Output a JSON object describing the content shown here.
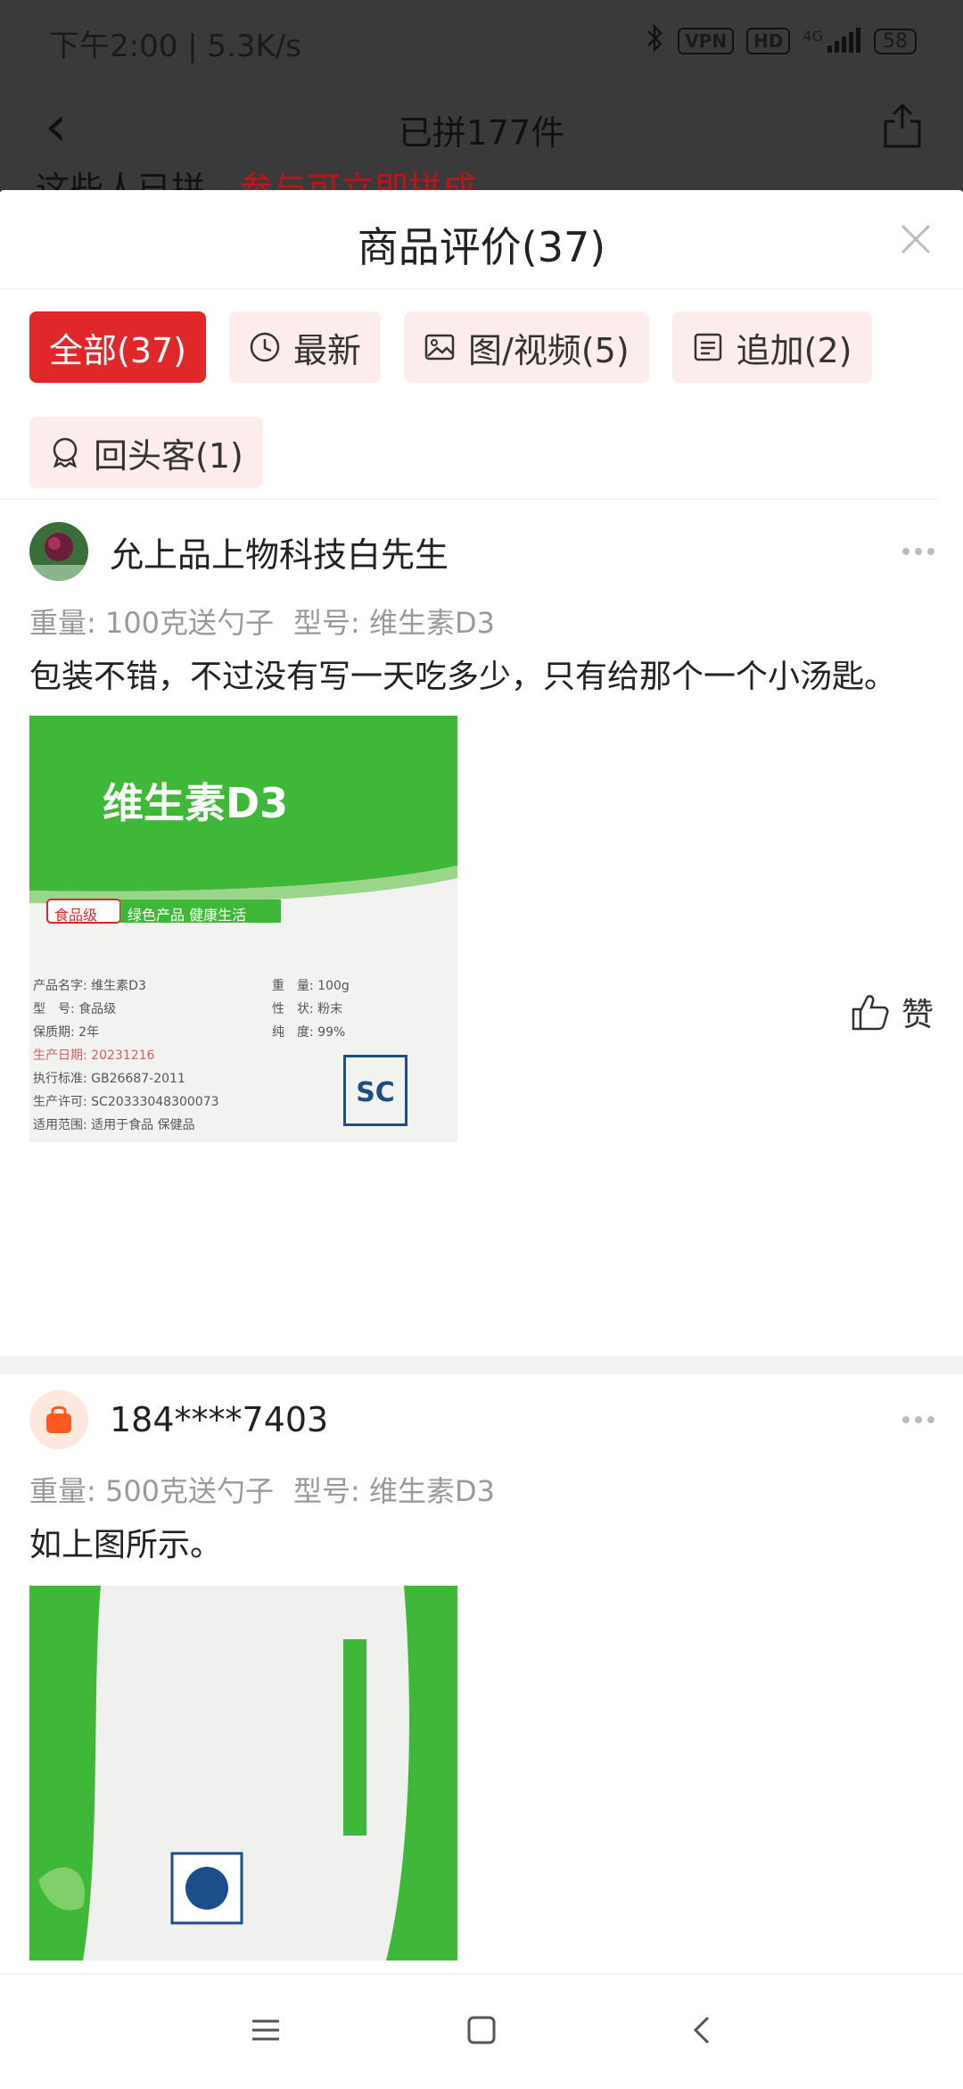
{
  "status_bar": {
    "time_speed": "下午2:00 | 5.3K/s",
    "vpn_badge": "VPN",
    "hd_badge": "HD",
    "network": "4G",
    "battery": "58"
  },
  "background_page": {
    "title": "已拼177件",
    "peek_text_black": "这些人已拼，",
    "peek_text_red": "参与可立即拼成"
  },
  "sheet": {
    "title": "商品评价(37)"
  },
  "filters": [
    {
      "label": "全部(37)",
      "active": true,
      "icon": ""
    },
    {
      "label": "最新",
      "active": false,
      "icon": "clock-icon"
    },
    {
      "label": "图/视频(5)",
      "active": false,
      "icon": "image-icon"
    },
    {
      "label": "追加(2)",
      "active": false,
      "icon": "document-icon"
    },
    {
      "label": "回头客(1)",
      "active": false,
      "icon": "badge-icon"
    }
  ],
  "reviews": [
    {
      "username": "允上品上物科技白先生",
      "spec_weight": "重量: 100克送勺子",
      "spec_model": "型号: 维生素D3",
      "content": "包装不错，不过没有写一天吃多少，只有给那个一个小汤匙。",
      "like_label": "赞",
      "photo": {
        "title": "维生素D3",
        "badge": "食品级",
        "tagline": "绿色产品 健康生活",
        "lines": [
          "产品名字: 维生素D3",
          "型　号: 食品级",
          "保质期: 2年",
          "生产日期: 20231216",
          "执行标准: GB26687-2011",
          "生产许可: SC20333048300073",
          "适用范围: 适用于食品 保健品"
        ],
        "right_lines": [
          "重　量: 100g",
          "性　状: 粉末",
          "纯　度: 99%"
        ],
        "sc": "SC"
      }
    },
    {
      "username": "184****7403",
      "spec_weight": "重量: 500克送勺子",
      "spec_model": "型号: 维生素D3",
      "content": "如上图所示。"
    }
  ],
  "colors": {
    "accent_red": "#e0282a",
    "chip_bg": "#fdecec",
    "package_green": "#3fb83a"
  }
}
